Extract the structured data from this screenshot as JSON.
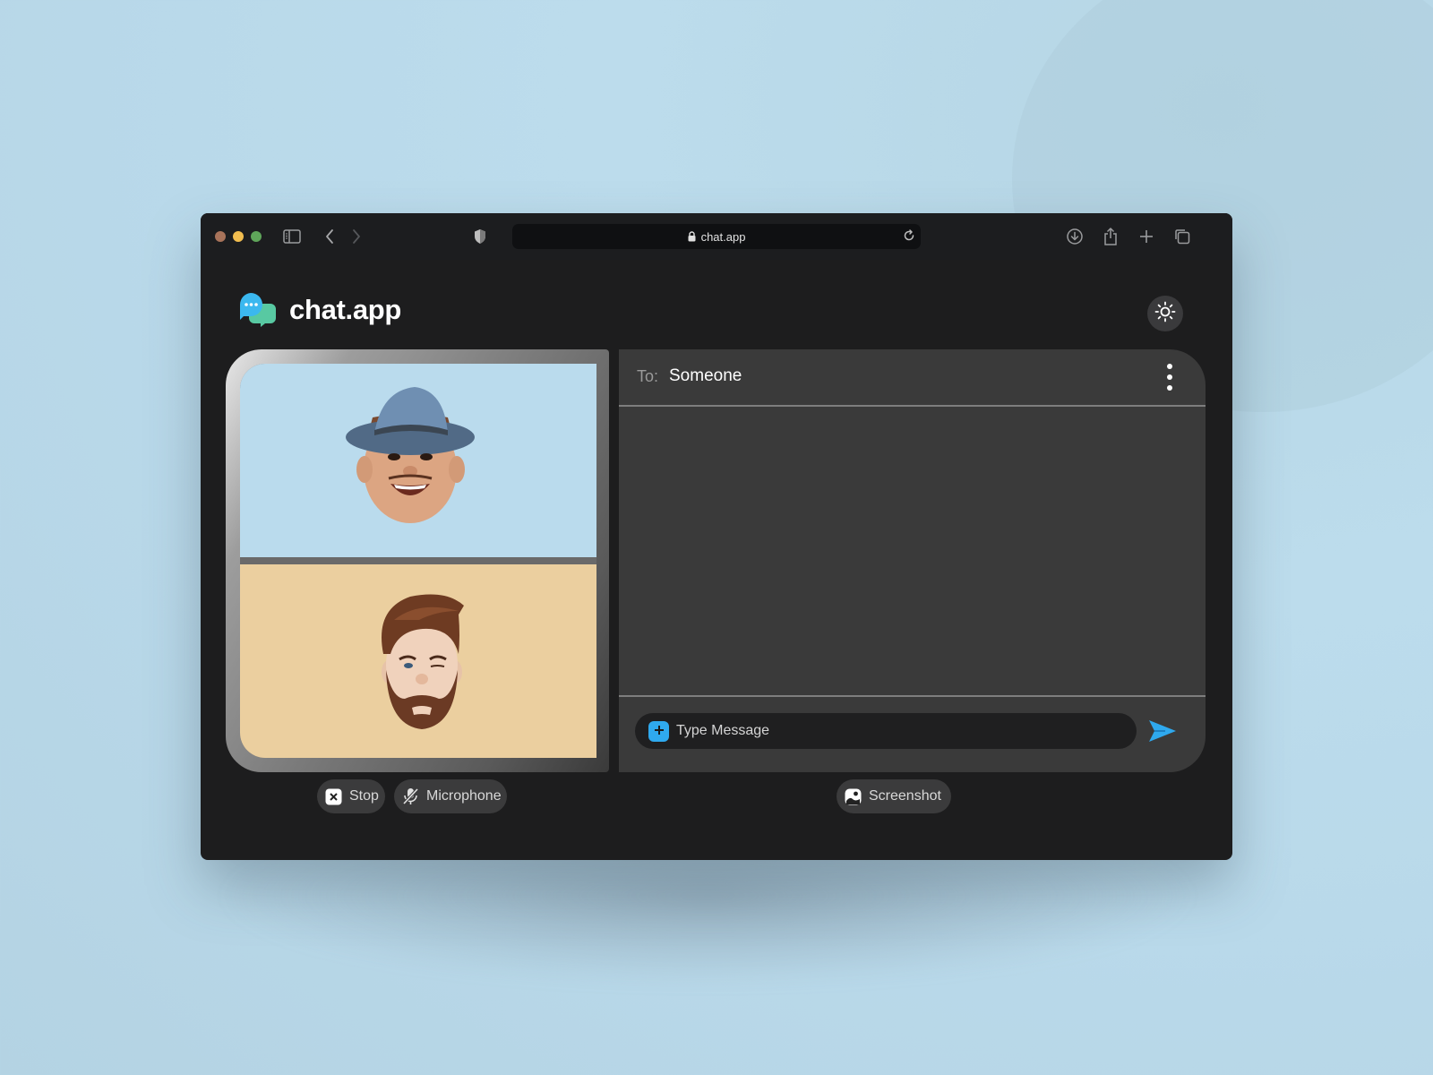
{
  "browser": {
    "url": "chat.app",
    "traffic_lights": {
      "close": "#a8735a",
      "minimize": "#f1bd4f",
      "maximize": "#5fa55a"
    },
    "icons": [
      "sidebar-icon",
      "back-icon",
      "forward-icon",
      "shield-icon",
      "lock-icon",
      "reload-icon",
      "download-icon",
      "share-icon",
      "new-tab-icon",
      "tabs-overview-icon"
    ]
  },
  "app": {
    "title": "chat.app",
    "logo_icon": "chat-bubbles-icon",
    "theme_toggle_icon": "sun-icon"
  },
  "video": {
    "participants": [
      {
        "avatar": "memoji-hat-man",
        "background": "#badbed"
      },
      {
        "avatar": "memoji-bearded-man",
        "background": "#ebcf9f"
      }
    ]
  },
  "chat": {
    "to_label": "To:",
    "recipient": "Someone",
    "menu_icon": "more-vertical-icon",
    "compose_placeholder": "Type Message",
    "compose_value": "",
    "attach_icon": "plus-icon",
    "send_icon": "send-icon",
    "accent": "#2fa9ee"
  },
  "controls": {
    "stop_label": "Stop",
    "microphone_label": "Microphone",
    "screenshot_label": "Screenshot"
  }
}
